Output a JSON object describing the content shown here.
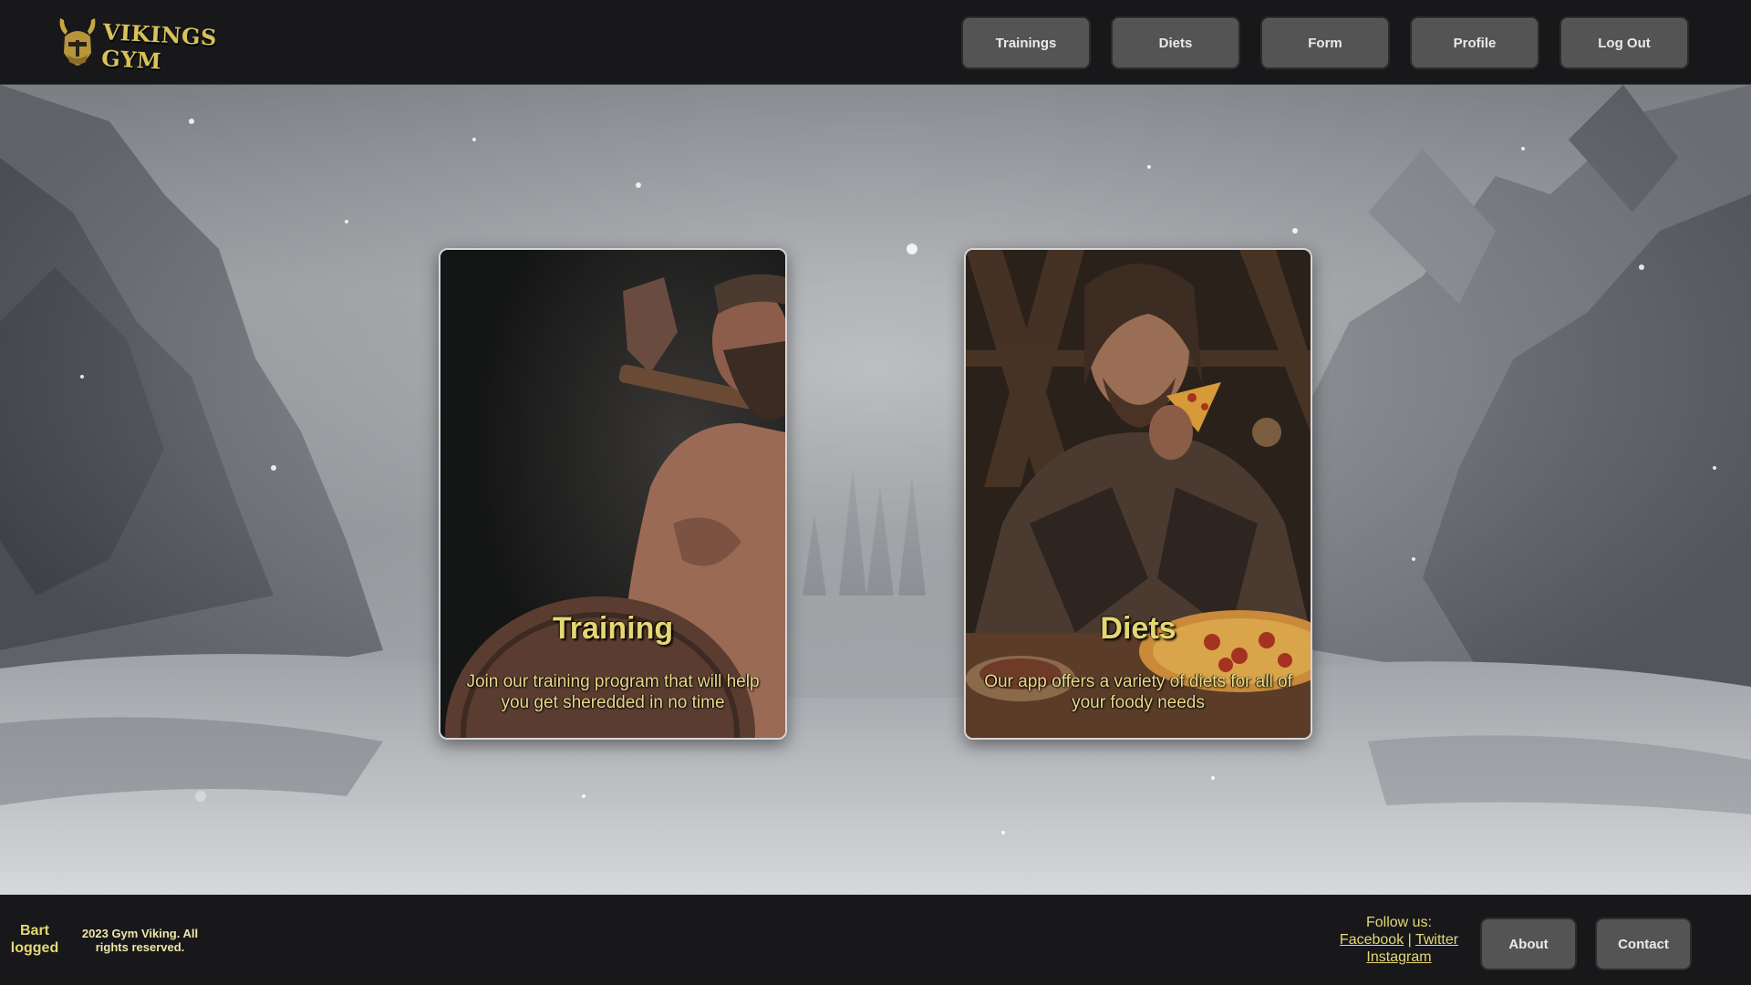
{
  "header": {
    "logo_text": "VIKINGS GYM",
    "nav": [
      {
        "label": "Trainings"
      },
      {
        "label": "Diets"
      },
      {
        "label": "Form"
      },
      {
        "label": "Profile"
      },
      {
        "label": "Log Out"
      }
    ]
  },
  "cards": [
    {
      "title": "Training",
      "description": "Join our training program that will help you get sheredded in no time",
      "image": "viking-with-axe-and-shield"
    },
    {
      "title": "Diets",
      "description": "Our app offers a variety of diets for all of your foody needs",
      "image": "viking-eating-pizza"
    }
  ],
  "footer": {
    "user_status": "Bart logged",
    "copyright": "2023 Gym Viking. All rights reserved.",
    "follow_label": "Follow us:",
    "social": {
      "facebook": "Facebook",
      "separator": "|",
      "twitter": "Twitter",
      "instagram": "Instagram"
    },
    "buttons": [
      {
        "label": "About"
      },
      {
        "label": "Contact"
      }
    ]
  },
  "colors": {
    "accent": "#e4d774",
    "header_bg": "#18181b",
    "button_bg": "#545454"
  }
}
